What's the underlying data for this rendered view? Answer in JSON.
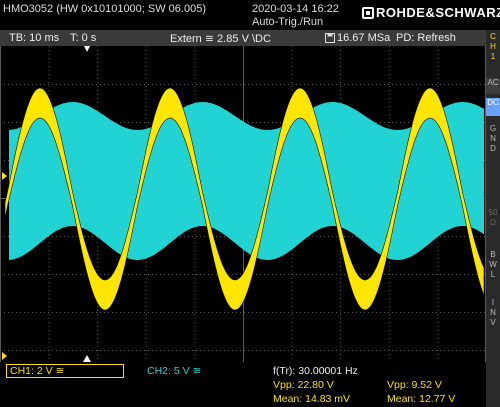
{
  "header": {
    "instrument": "HMO3052 (HW 0x10101000; SW 06.005)",
    "datetime": "2020-03-14 16:22",
    "trigger_mode": "Auto-Trig./Run",
    "brand": "ROHDE&SCHWARZ"
  },
  "infobar": {
    "timebase": "TB: 10 ms",
    "trigger_time": "T: 0 s",
    "trigger_info": "Extern ≅ 2.85 V \\DC",
    "sample_rate": "16.67 MSa",
    "display_mode": "PD: Refresh"
  },
  "channel_panel": {
    "channel": "C\nH\n1",
    "ac": "AC",
    "dc": "DC",
    "gnd": "G\nN\nD",
    "impedance": "50\nΩ",
    "bwl": "B\nW\nL",
    "inv": "I\nN\nV"
  },
  "measurements": {
    "ch1_setting": "CH1: 2 V ≅",
    "ch2_setting": "CH2: 5 V ≅",
    "frequency": "f(Tr): 30.00001 Hz",
    "ch1_vpp": "Vpp: 22.80 V",
    "ch1_mean": "Mean: 14.83 mV",
    "ch2_vpp": "Vpp: 9.52 V",
    "ch2_mean": "Mean: 12.77 V"
  },
  "colors": {
    "ch1": "#ffe600",
    "ch2": "#22d3d3",
    "grid": "#5a5a5a",
    "background": "#000000"
  },
  "waveform": {
    "ch1_frequency_hz": 30.00001,
    "ch1_vpp_v": 22.8,
    "ch2_vpp_v": 9.52,
    "timebase_s_per_div": 0.01
  }
}
